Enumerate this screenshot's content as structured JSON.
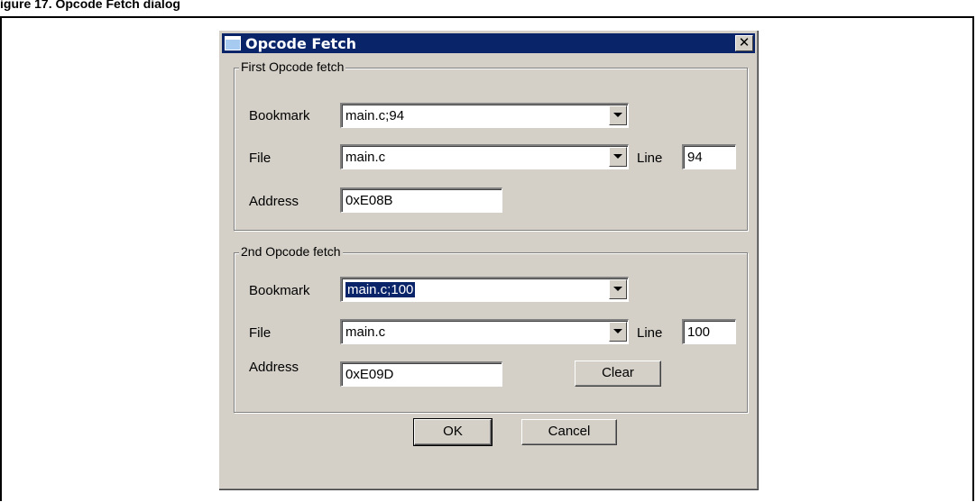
{
  "figure": {
    "caption": "igure 17. Opcode Fetch dialog"
  },
  "dialog": {
    "title": "Opcode Fetch",
    "close_glyph": "✕",
    "icon": "window-icon"
  },
  "first_fetch": {
    "group_label": "First Opcode fetch",
    "bookmark_label": "Bookmark",
    "bookmark_value": "main.c;94",
    "file_label": "File",
    "file_value": "main.c",
    "line_label": "Line",
    "line_value": "94",
    "address_label": "Address",
    "address_value": "0xE08B"
  },
  "second_fetch": {
    "group_label": "2nd Opcode fetch",
    "bookmark_label": "Bookmark",
    "bookmark_value": "main.c;100",
    "file_label": "File",
    "file_value": "main.c",
    "line_label": "Line",
    "line_value": "100",
    "address_label": "Address",
    "address_value": "0xE09D",
    "clear_label": "Clear"
  },
  "buttons": {
    "ok_label": "OK",
    "cancel_label": "Cancel"
  }
}
